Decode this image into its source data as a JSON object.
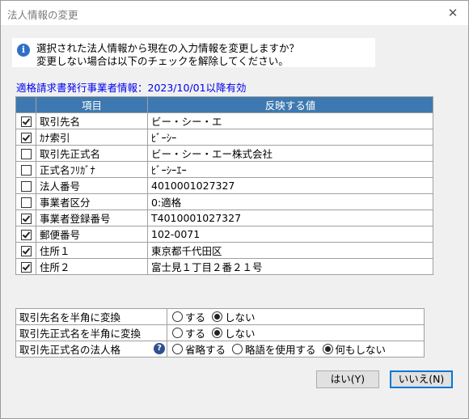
{
  "window": {
    "title": "法人情報の変更",
    "close_glyph": "✕"
  },
  "message": {
    "icon": "info-icon",
    "line1": "選択された法人情報から現在の入力情報を変更しますか？",
    "line2": "変更しない場合は以下のチェックを解除してください。"
  },
  "invoice_note": "適格請求書発行事業者情報：2023/10/01以降有効",
  "grid": {
    "headers": [
      "",
      "項目",
      "反映する値"
    ],
    "rows": [
      {
        "checked": true,
        "item": "取引先名",
        "value": "ビー・シー・エ"
      },
      {
        "checked": true,
        "item": "ｶﾅ索引",
        "value": "ﾋﾞｰｼｰ"
      },
      {
        "checked": false,
        "item": "取引先正式名",
        "value": "ビー・シー・エー株式会社"
      },
      {
        "checked": false,
        "item": "正式名ﾌﾘｶﾞﾅ",
        "value": "ﾋﾞｰｼｰｴｰ"
      },
      {
        "checked": false,
        "item": "法人番号",
        "value": "4010001027327"
      },
      {
        "checked": false,
        "item": "事業者区分",
        "value": "0:適格"
      },
      {
        "checked": true,
        "item": "事業者登録番号",
        "value": "T4010001027327"
      },
      {
        "checked": true,
        "item": "郵便番号",
        "value": "102-0071"
      },
      {
        "checked": true,
        "item": "住所１",
        "value": "東京都千代田区"
      },
      {
        "checked": true,
        "item": "住所２",
        "value": "富士見１丁目２番２１号"
      }
    ]
  },
  "options": [
    {
      "label": "取引先名を半角に変換",
      "help": false,
      "choices": [
        {
          "text": "する",
          "selected": false
        },
        {
          "text": "しない",
          "selected": true
        }
      ]
    },
    {
      "label": "取引先正式名を半角に変換",
      "help": false,
      "choices": [
        {
          "text": "する",
          "selected": false
        },
        {
          "text": "しない",
          "selected": true
        }
      ]
    },
    {
      "label": "取引先正式名の法人格",
      "help": true,
      "choices": [
        {
          "text": "省略する",
          "selected": false
        },
        {
          "text": "略語を使用する",
          "selected": false
        },
        {
          "text": "何もしない",
          "selected": true
        }
      ]
    }
  ],
  "help_glyph": "?",
  "buttons": {
    "yes": "はい(Y)",
    "no": "いいえ(N)"
  }
}
